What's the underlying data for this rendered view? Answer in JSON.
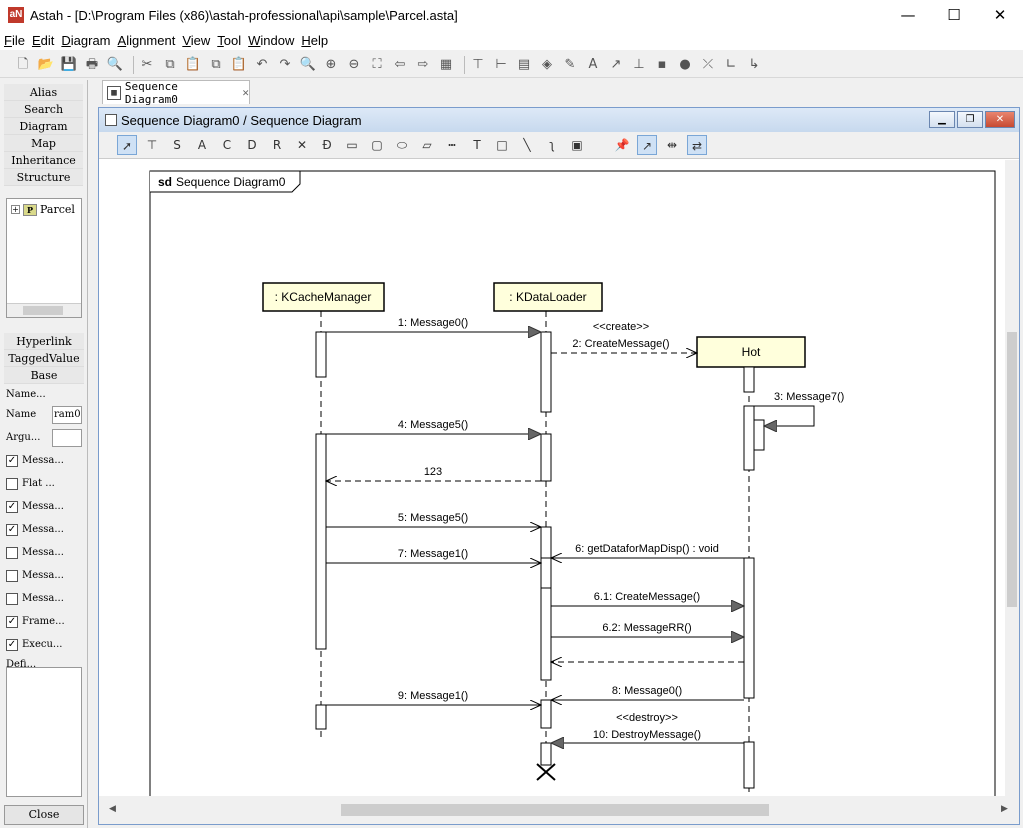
{
  "window": {
    "title": "Astah - [D:\\Program Files (x86)\\astah-professional\\api\\sample\\Parcel.asta]",
    "logo": "aN",
    "minimize": "—",
    "maximize": "☐",
    "close": "✕"
  },
  "menu": [
    "File",
    "Edit",
    "Diagram",
    "Alignment",
    "View",
    "Tool",
    "Window",
    "Help"
  ],
  "left_panel": {
    "tabs": [
      "Alias",
      "Search",
      "Diagram",
      "Map",
      "Inheritance",
      "Structure"
    ],
    "tree": {
      "expander": "+",
      "icon": "P",
      "item": "Parcel"
    },
    "prop_tabs": [
      "Hyperlink",
      "TaggedValue",
      "Base"
    ],
    "name_header": "Name...",
    "name_label": "Name",
    "name_value": "ram0",
    "argu_label": "Argu...",
    "checkboxes": [
      {
        "label": "Messa...",
        "checked": true
      },
      {
        "label": "Flat ...",
        "checked": false
      },
      {
        "label": "Messa...",
        "checked": true
      },
      {
        "label": "Messa...",
        "checked": true
      },
      {
        "label": "Messa...",
        "checked": false
      },
      {
        "label": "Messa...",
        "checked": false
      },
      {
        "label": "Messa...",
        "checked": false
      },
      {
        "label": "Frame...",
        "checked": true
      },
      {
        "label": "Execu...",
        "checked": true
      }
    ],
    "defi_label": "Defi...",
    "close_label": "Close"
  },
  "doc_tab": {
    "label": "Sequence Diagram0",
    "close": "✕"
  },
  "internal_frame": {
    "title": "Sequence Diagram0 / Sequence Diagram"
  },
  "diagram": {
    "frame_label_kw": "sd",
    "frame_label": "Sequence Diagram0",
    "lifelines": [
      {
        "name": ": KCacheManager"
      },
      {
        "name": ": KDataLoader"
      },
      {
        "name": "Hot"
      }
    ],
    "messages": {
      "m1": "1: Message0()",
      "create_stereo": "<<create>>",
      "m2": "2: CreateMessage()",
      "m3": "3: Message7()",
      "m4": "4: Message5()",
      "ret123": "123",
      "m5": "5: Message5()",
      "m7": "7: Message1()",
      "m6": "6: getDataforMapDisp() : void",
      "m61": "6.1: CreateMessage()",
      "m62": "6.2: MessageRR()",
      "m8": "8: Message0()",
      "m9": "9: Message1()",
      "destroy_stereo": "<<destroy>>",
      "m10": "10: DestroyMessage()"
    }
  },
  "colors": {
    "lifeline_fill": "#ffffdc",
    "frame_title_bar": "#c7d9ee",
    "close_button": "#c74a32"
  }
}
